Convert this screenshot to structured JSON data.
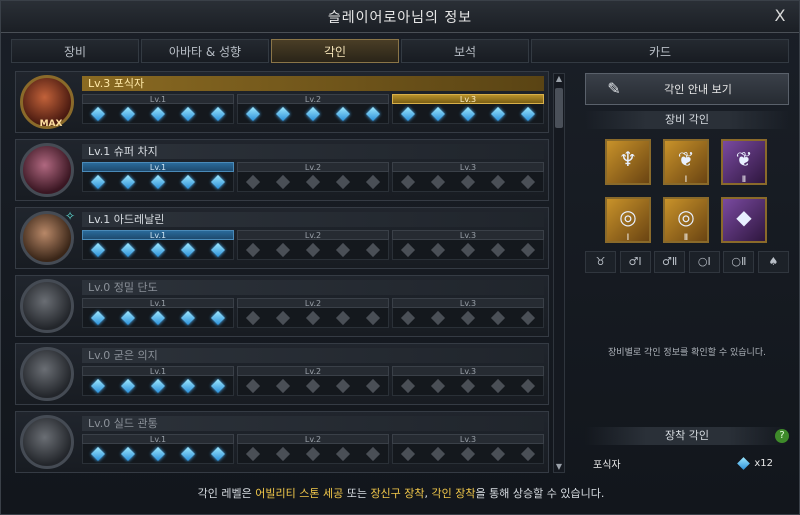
{
  "window": {
    "title": "슬레이어로아님의 정보",
    "close_symbol": "X"
  },
  "tabs": [
    {
      "label": "장비",
      "active": false
    },
    {
      "label": "아바타 & 성향",
      "active": false
    },
    {
      "label": "각인",
      "active": true
    },
    {
      "label": "보석",
      "active": false
    },
    {
      "label": "카드",
      "active": false
    }
  ],
  "level_labels": [
    "Lv.1",
    "Lv.2",
    "Lv.3"
  ],
  "engravings": [
    {
      "title": "Lv.3 포식자",
      "badge": "MAX",
      "levels": [
        {
          "gems": [
            1,
            1,
            1,
            1,
            1
          ],
          "state": "done"
        },
        {
          "gems": [
            1,
            1,
            1,
            1,
            1
          ],
          "state": "done"
        },
        {
          "gems": [
            1,
            1,
            1,
            1,
            1
          ],
          "state": "gold"
        }
      ]
    },
    {
      "title": "Lv.1 슈퍼 차지",
      "badge": "",
      "levels": [
        {
          "gems": [
            1,
            1,
            1,
            1,
            1
          ],
          "state": "blue"
        },
        {
          "gems": [
            0,
            0,
            0,
            0,
            0
          ],
          "state": "none"
        },
        {
          "gems": [
            0,
            0,
            0,
            0,
            0
          ],
          "state": "none"
        }
      ]
    },
    {
      "title": "Lv.1 아드레날린",
      "badge": "",
      "levels": [
        {
          "gems": [
            1,
            1,
            1,
            1,
            1
          ],
          "state": "blue"
        },
        {
          "gems": [
            0,
            0,
            0,
            0,
            0
          ],
          "state": "none"
        },
        {
          "gems": [
            0,
            0,
            0,
            0,
            0
          ],
          "state": "none"
        }
      ]
    },
    {
      "title": "Lv.0 정밀 단도",
      "badge": "",
      "levels": [
        {
          "gems": [
            1,
            1,
            1,
            1,
            1
          ],
          "state": "none"
        },
        {
          "gems": [
            0,
            0,
            0,
            0,
            0
          ],
          "state": "none"
        },
        {
          "gems": [
            0,
            0,
            0,
            0,
            0
          ],
          "state": "none"
        }
      ]
    },
    {
      "title": "Lv.0 굳은 의지",
      "badge": "",
      "levels": [
        {
          "gems": [
            1,
            1,
            1,
            1,
            1
          ],
          "state": "none"
        },
        {
          "gems": [
            0,
            0,
            0,
            0,
            0
          ],
          "state": "none"
        },
        {
          "gems": [
            0,
            0,
            0,
            0,
            0
          ],
          "state": "none"
        }
      ]
    },
    {
      "title": "Lv.0 실드 관통",
      "badge": "",
      "levels": [
        {
          "gems": [
            1,
            1,
            1,
            1,
            1
          ],
          "state": "none"
        },
        {
          "gems": [
            0,
            0,
            0,
            0,
            0
          ],
          "state": "none"
        },
        {
          "gems": [
            0,
            0,
            0,
            0,
            0
          ],
          "state": "none"
        }
      ]
    }
  ],
  "right_panel": {
    "guide_button": "각인 안내 보기",
    "equipment_title": "장비 각인",
    "slots": [
      {
        "icon": "necklace-icon",
        "num": ""
      },
      {
        "icon": "earring-icon",
        "num": "Ⅰ"
      },
      {
        "icon": "earring-icon",
        "num": "Ⅱ"
      },
      {
        "icon": "ring-icon",
        "num": "Ⅰ"
      },
      {
        "icon": "ring-icon",
        "num": "Ⅱ"
      },
      {
        "icon": "stone-icon",
        "num": ""
      }
    ],
    "filters": [
      "♉",
      "♂Ⅰ",
      "♂Ⅱ",
      "○Ⅰ",
      "○Ⅱ",
      "♠"
    ],
    "info_text": "장비별로 각인 정보를 확인할 수 있습니다.",
    "mount_title": "장착 각인",
    "help_symbol": "?",
    "mounted": {
      "name": "포식자",
      "count": "x12"
    }
  },
  "footer": {
    "part1": "각인 레벨은 ",
    "hl1": "어빌리티 스톤 세공",
    "part2": " 또는 ",
    "hl2": "장신구 장착",
    "part3": ", ",
    "hl3": "각인 장착",
    "part4": "을 통해 상승할 수 있습니다."
  },
  "colors": {
    "accent_gold": "#f2c84a",
    "gem_blue": "#4ab6ff"
  }
}
